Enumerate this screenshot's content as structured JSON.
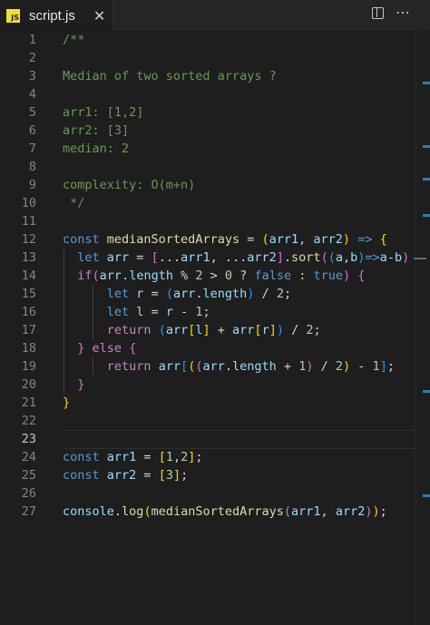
{
  "tab": {
    "badge": "JS",
    "filename": "script.js",
    "close_glyph": "✕"
  },
  "toolbar": {
    "split_icon": "split-editor-icon",
    "more_glyph": "⋯"
  },
  "colors": {
    "background": "#1e1e1e",
    "comment": "#6a9955",
    "keyword": "#569cd6",
    "control": "#c586c0",
    "function": "#dcdcaa",
    "variable": "#9cdcfe",
    "number": "#b5cea8",
    "js_badge": "#f1dd35"
  },
  "editor": {
    "active_line": 23,
    "lines": [
      {
        "n": "1",
        "tokens": [
          [
            "c-com",
            "/**"
          ]
        ]
      },
      {
        "n": "2",
        "tokens": []
      },
      {
        "n": "3",
        "tokens": [
          [
            "c-com",
            "Median of two sorted arrays ?"
          ]
        ]
      },
      {
        "n": "4",
        "tokens": []
      },
      {
        "n": "5",
        "tokens": [
          [
            "c-com",
            "arr1: [1,2]"
          ]
        ]
      },
      {
        "n": "6",
        "tokens": [
          [
            "c-com",
            "arr2: [3]"
          ]
        ]
      },
      {
        "n": "7",
        "tokens": [
          [
            "c-com",
            "median: 2"
          ]
        ]
      },
      {
        "n": "8",
        "tokens": []
      },
      {
        "n": "9",
        "tokens": [
          [
            "c-com",
            "complexity: O(m+n)"
          ]
        ]
      },
      {
        "n": "10",
        "tokens": [
          [
            "c-com",
            " */"
          ]
        ]
      },
      {
        "n": "11",
        "tokens": []
      },
      {
        "n": "12",
        "tokens": [
          [
            "c-kw",
            "const "
          ],
          [
            "c-fn",
            "medianSortedArrays"
          ],
          [
            "c-txt",
            " = "
          ],
          [
            "c-brk-y",
            "("
          ],
          [
            "c-var",
            "arr1"
          ],
          [
            "c-txt",
            ", "
          ],
          [
            "c-var",
            "arr2"
          ],
          [
            "c-brk-y",
            ")"
          ],
          [
            "c-txt",
            " "
          ],
          [
            "c-kw",
            "=>"
          ],
          [
            "c-txt",
            " "
          ],
          [
            "c-brk-y",
            "{"
          ]
        ]
      },
      {
        "n": "13",
        "tokens": [
          [
            "c-txt",
            "  "
          ],
          [
            "c-kw",
            "let "
          ],
          [
            "c-var",
            "arr"
          ],
          [
            "c-txt",
            " = "
          ],
          [
            "c-brk-p",
            "["
          ],
          [
            "c-txt",
            "..."
          ],
          [
            "c-var",
            "arr1"
          ],
          [
            "c-txt",
            ", ..."
          ],
          [
            "c-var",
            "arr2"
          ],
          [
            "c-brk-p",
            "]"
          ],
          [
            "c-txt",
            "."
          ],
          [
            "c-fn",
            "sort"
          ],
          [
            "c-brk-p",
            "("
          ],
          [
            "c-brk-b",
            "("
          ],
          [
            "c-var",
            "a"
          ],
          [
            "c-txt",
            ","
          ],
          [
            "c-var",
            "b"
          ],
          [
            "c-brk-b",
            ")"
          ],
          [
            "c-kw",
            "=>"
          ],
          [
            "c-var",
            "a"
          ],
          [
            "c-txt",
            "-"
          ],
          [
            "c-var",
            "b"
          ],
          [
            "c-brk-p",
            ")"
          ]
        ]
      },
      {
        "n": "14",
        "tokens": [
          [
            "c-txt",
            "  "
          ],
          [
            "c-ctl",
            "if"
          ],
          [
            "c-brk-p",
            "("
          ],
          [
            "c-var",
            "arr"
          ],
          [
            "c-txt",
            "."
          ],
          [
            "c-var",
            "length"
          ],
          [
            "c-txt",
            " % "
          ],
          [
            "c-num",
            "2"
          ],
          [
            "c-txt",
            " > "
          ],
          [
            "c-num",
            "0"
          ],
          [
            "c-txt",
            " ? "
          ],
          [
            "c-kw",
            "false"
          ],
          [
            "c-txt",
            " : "
          ],
          [
            "c-kw",
            "true"
          ],
          [
            "c-brk-p",
            ")"
          ],
          [
            "c-txt",
            " "
          ],
          [
            "c-brk-p",
            "{"
          ]
        ]
      },
      {
        "n": "15",
        "tokens": [
          [
            "c-txt",
            "      "
          ],
          [
            "c-kw",
            "let "
          ],
          [
            "c-var",
            "r"
          ],
          [
            "c-txt",
            " = "
          ],
          [
            "c-brk-b",
            "("
          ],
          [
            "c-var",
            "arr"
          ],
          [
            "c-txt",
            "."
          ],
          [
            "c-var",
            "length"
          ],
          [
            "c-brk-b",
            ")"
          ],
          [
            "c-txt",
            " / "
          ],
          [
            "c-num",
            "2"
          ],
          [
            "c-txt",
            ";"
          ]
        ]
      },
      {
        "n": "16",
        "tokens": [
          [
            "c-txt",
            "      "
          ],
          [
            "c-kw",
            "let "
          ],
          [
            "c-var",
            "l"
          ],
          [
            "c-txt",
            " = "
          ],
          [
            "c-var",
            "r"
          ],
          [
            "c-txt",
            " - "
          ],
          [
            "c-num",
            "1"
          ],
          [
            "c-txt",
            ";"
          ]
        ]
      },
      {
        "n": "17",
        "tokens": [
          [
            "c-txt",
            "      "
          ],
          [
            "c-ctl",
            "return "
          ],
          [
            "c-brk-b",
            "("
          ],
          [
            "c-var",
            "arr"
          ],
          [
            "c-brk-y",
            "["
          ],
          [
            "c-var",
            "l"
          ],
          [
            "c-brk-y",
            "]"
          ],
          [
            "c-txt",
            " + "
          ],
          [
            "c-var",
            "arr"
          ],
          [
            "c-brk-y",
            "["
          ],
          [
            "c-var",
            "r"
          ],
          [
            "c-brk-y",
            "]"
          ],
          [
            "c-brk-b",
            ")"
          ],
          [
            "c-txt",
            " / "
          ],
          [
            "c-num",
            "2"
          ],
          [
            "c-txt",
            ";"
          ]
        ]
      },
      {
        "n": "18",
        "tokens": [
          [
            "c-txt",
            "  "
          ],
          [
            "c-brk-p",
            "}"
          ],
          [
            "c-txt",
            " "
          ],
          [
            "c-ctl",
            "else"
          ],
          [
            "c-txt",
            " "
          ],
          [
            "c-brk-p",
            "{"
          ]
        ]
      },
      {
        "n": "19",
        "tokens": [
          [
            "c-txt",
            "      "
          ],
          [
            "c-ctl",
            "return "
          ],
          [
            "c-var",
            "arr"
          ],
          [
            "c-brk-b",
            "["
          ],
          [
            "c-brk-y",
            "("
          ],
          [
            "c-brk-p",
            "("
          ],
          [
            "c-var",
            "arr"
          ],
          [
            "c-txt",
            "."
          ],
          [
            "c-var",
            "length"
          ],
          [
            "c-txt",
            " + "
          ],
          [
            "c-num",
            "1"
          ],
          [
            "c-brk-p",
            ")"
          ],
          [
            "c-txt",
            " / "
          ],
          [
            "c-num",
            "2"
          ],
          [
            "c-brk-y",
            ")"
          ],
          [
            "c-txt",
            " - "
          ],
          [
            "c-num",
            "1"
          ],
          [
            "c-brk-b",
            "]"
          ],
          [
            "c-txt",
            ";"
          ]
        ]
      },
      {
        "n": "20",
        "tokens": [
          [
            "c-txt",
            "  "
          ],
          [
            "c-brk-p",
            "}"
          ]
        ]
      },
      {
        "n": "21",
        "tokens": [
          [
            "c-brk-y",
            "}"
          ]
        ]
      },
      {
        "n": "22",
        "tokens": []
      },
      {
        "n": "23",
        "tokens": []
      },
      {
        "n": "24",
        "tokens": [
          [
            "c-kw",
            "const "
          ],
          [
            "c-var",
            "arr1"
          ],
          [
            "c-txt",
            " = "
          ],
          [
            "c-brk-y",
            "["
          ],
          [
            "c-num",
            "1"
          ],
          [
            "c-txt",
            ","
          ],
          [
            "c-num",
            "2"
          ],
          [
            "c-brk-y",
            "]"
          ],
          [
            "c-txt",
            ";"
          ]
        ]
      },
      {
        "n": "25",
        "tokens": [
          [
            "c-kw",
            "const "
          ],
          [
            "c-var",
            "arr2"
          ],
          [
            "c-txt",
            " = "
          ],
          [
            "c-brk-y",
            "["
          ],
          [
            "c-num",
            "3"
          ],
          [
            "c-brk-y",
            "]"
          ],
          [
            "c-txt",
            ";"
          ]
        ]
      },
      {
        "n": "26",
        "tokens": []
      },
      {
        "n": "27",
        "tokens": [
          [
            "c-var",
            "console"
          ],
          [
            "c-txt",
            "."
          ],
          [
            "c-fn",
            "log"
          ],
          [
            "c-brk-y",
            "("
          ],
          [
            "c-fn",
            "medianSortedArrays"
          ],
          [
            "c-brk-p",
            "("
          ],
          [
            "c-var",
            "arr1"
          ],
          [
            "c-txt",
            ", "
          ],
          [
            "c-var",
            "arr2"
          ],
          [
            "c-brk-p",
            ")"
          ],
          [
            "c-brk-y",
            ")"
          ],
          [
            "c-txt",
            ";"
          ]
        ]
      }
    ]
  }
}
